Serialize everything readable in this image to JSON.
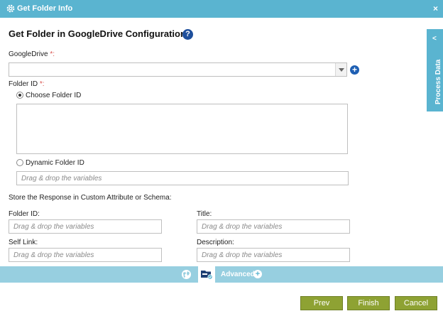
{
  "window": {
    "title": "Get Folder Info",
    "close_label": "×"
  },
  "heading": "Get Folder in GoogleDrive Configuration",
  "help_glyph": "?",
  "googledrive": {
    "label": "GoogleDrive",
    "required_mark": "*:",
    "value": ""
  },
  "add_glyph": "+",
  "folder_id": {
    "label": "Folder ID",
    "required_mark": "*:",
    "option_choose": "Choose Folder ID",
    "option_dynamic": "Dynamic Folder ID",
    "dynamic_placeholder": "Drag & drop the variables"
  },
  "store": {
    "label": "Store the Response in Custom Attribute or Schema:",
    "fields": {
      "folder_id": {
        "label": "Folder ID:",
        "placeholder": "Drag & drop the variables"
      },
      "title": {
        "label": "Title:",
        "placeholder": "Drag & drop the variables"
      },
      "self_link": {
        "label": "Self Link:",
        "placeholder": "Drag & drop the variables"
      },
      "description": {
        "label": "Description:",
        "placeholder": "Drag & drop the variables"
      }
    }
  },
  "process_data": {
    "label": "Process Data",
    "chevron": "<"
  },
  "footer": {
    "advanced_label": "Advanced",
    "advanced_plus": "+"
  },
  "buttons": {
    "prev": "Prev",
    "finish": "Finish",
    "cancel": "Cancel"
  },
  "colors": {
    "header": "#5ab4d0",
    "footer_bar": "#97cfe0",
    "button": "#8ea233",
    "help": "#1e4f9c"
  }
}
